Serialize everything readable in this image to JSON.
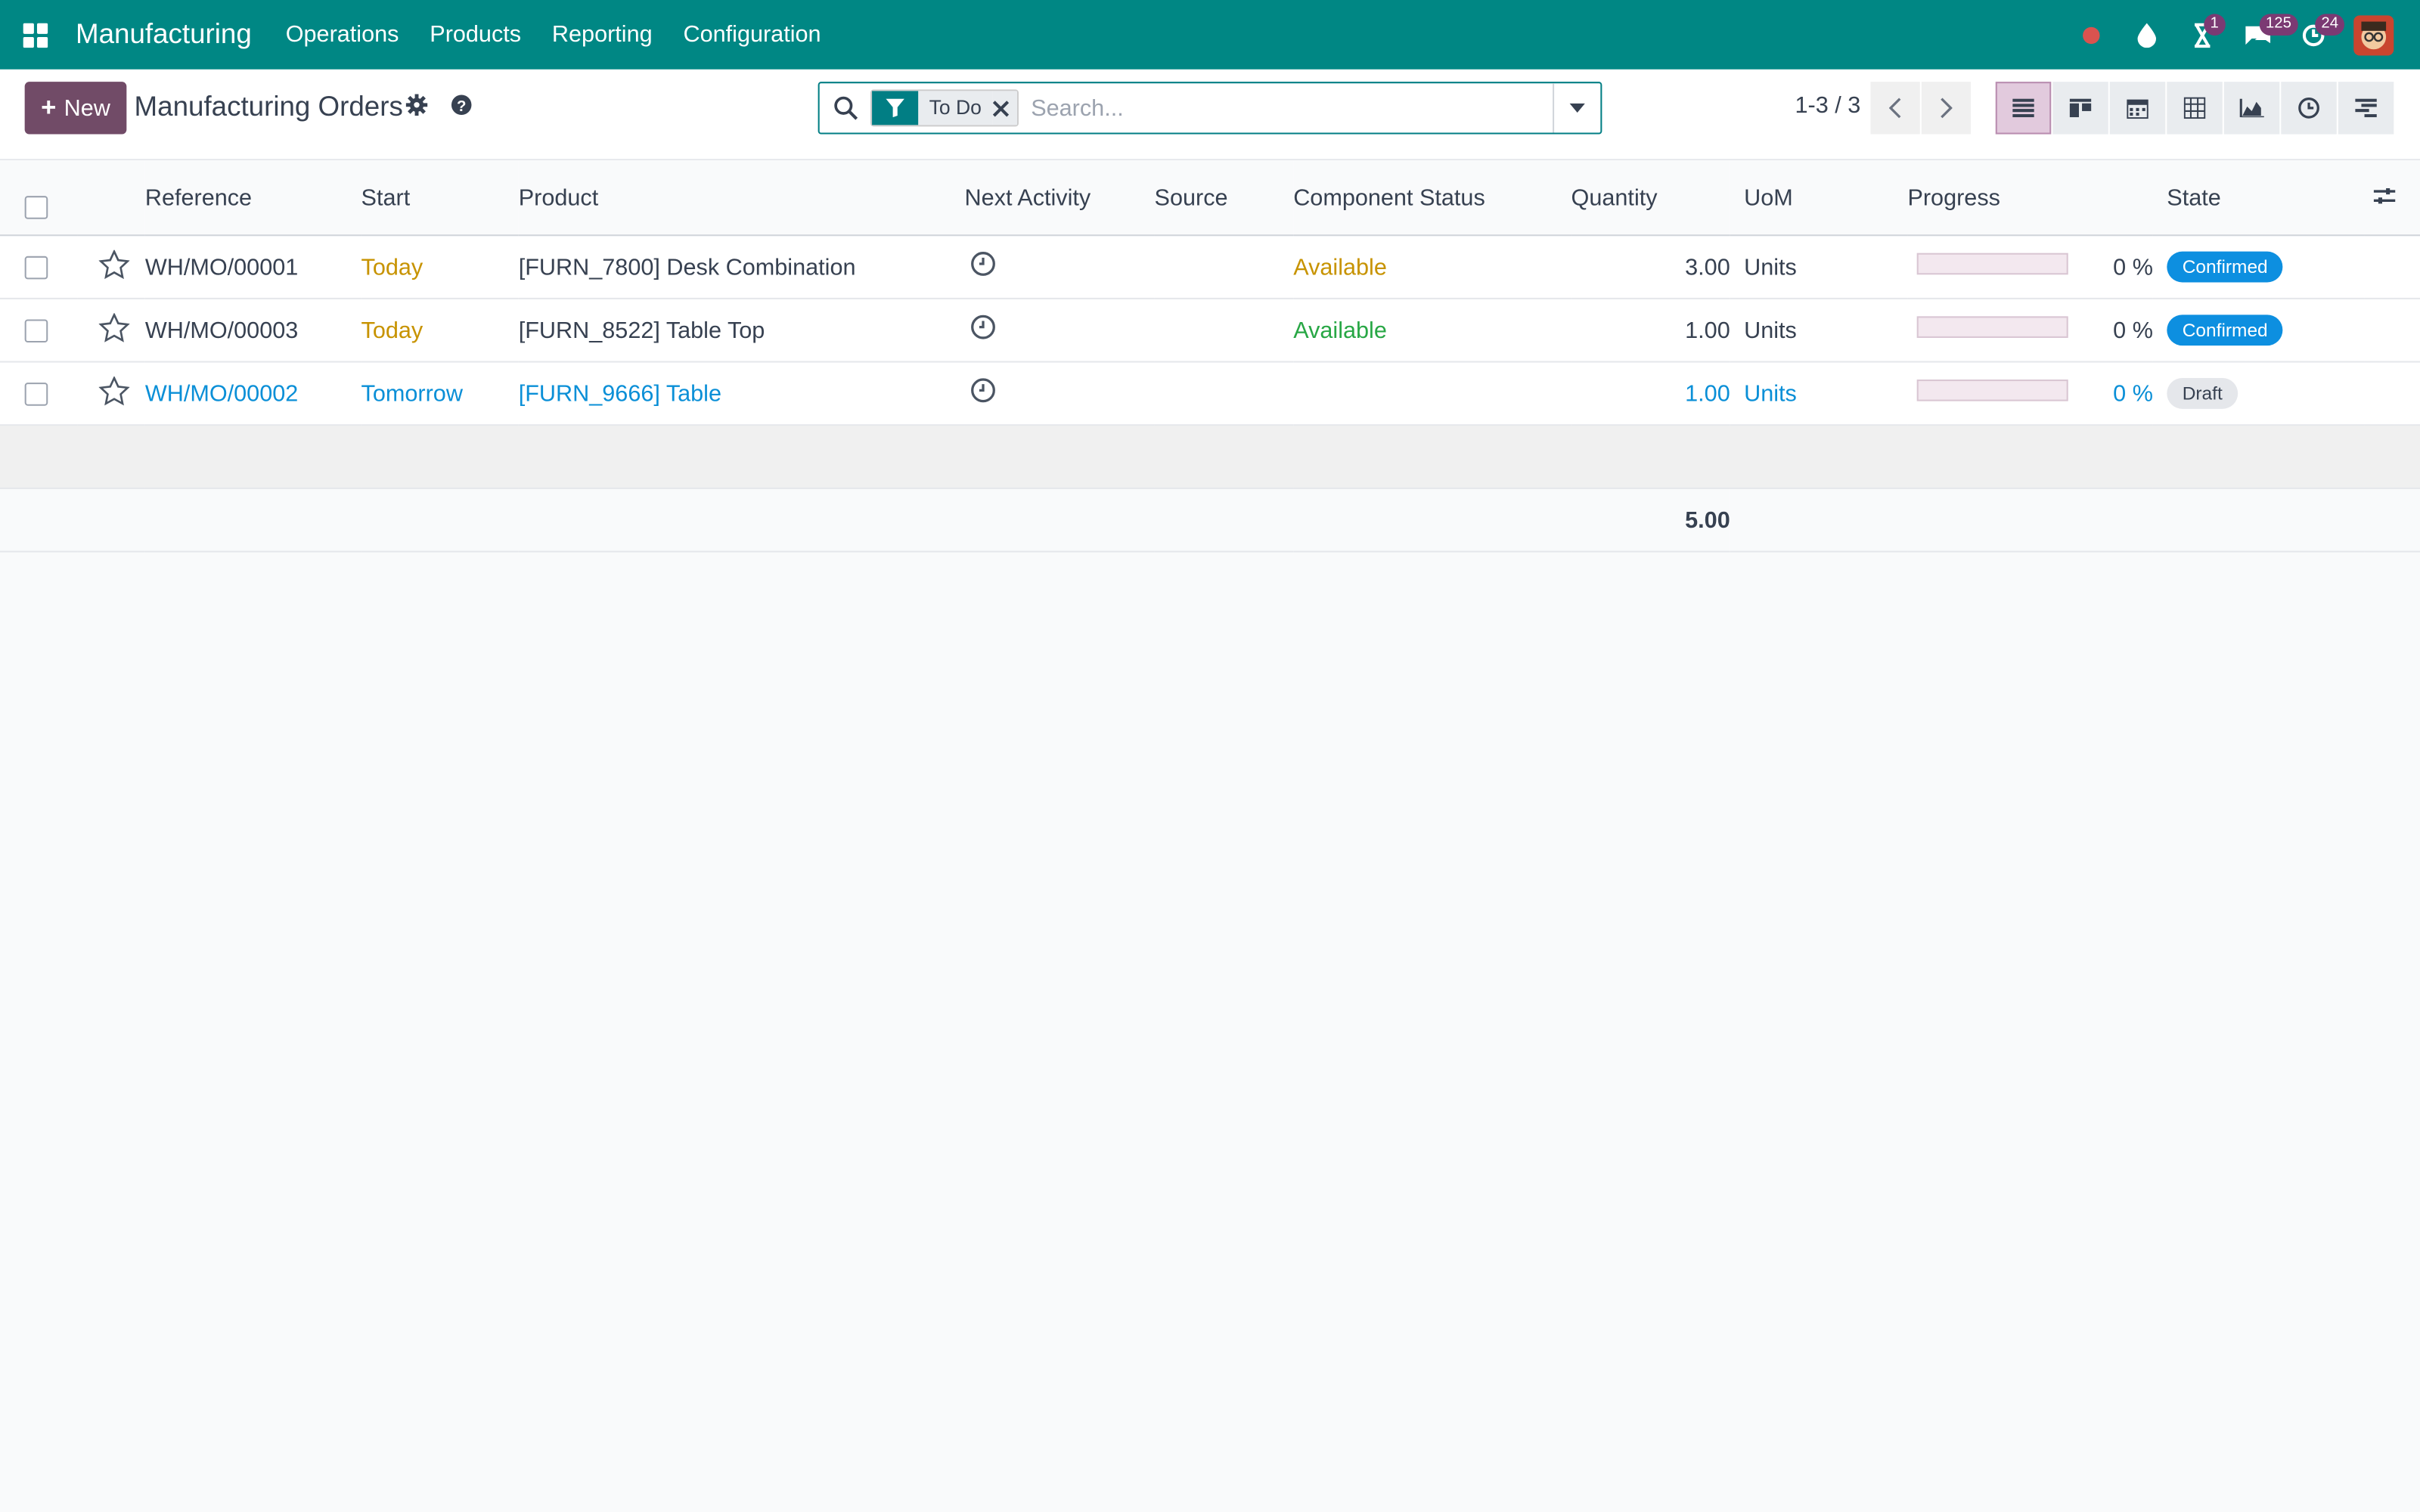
{
  "navbar": {
    "app_title": "Manufacturing",
    "menu": [
      "Operations",
      "Products",
      "Reporting",
      "Configuration"
    ],
    "badges": {
      "activities": "1",
      "messages": "125",
      "updates": "24"
    },
    "brand_color": "#008784"
  },
  "control_panel": {
    "new_label": "New",
    "page_title": "Manufacturing Orders",
    "search": {
      "facet_label": "To Do",
      "placeholder": "Search..."
    },
    "pager": "1-3 / 3"
  },
  "table": {
    "headers": {
      "reference": "Reference",
      "start": "Start",
      "product": "Product",
      "next_activity": "Next Activity",
      "source": "Source",
      "component_status": "Component Status",
      "quantity": "Quantity",
      "uom": "UoM",
      "progress": "Progress",
      "state": "State"
    },
    "rows": [
      {
        "reference": "WH/MO/00001",
        "start": "Today",
        "product": "[FURN_7800] Desk Combination",
        "source": "",
        "component_status": "Available",
        "quantity": "3.00",
        "uom": "Units",
        "progress": "0 %",
        "state": "Confirmed"
      },
      {
        "reference": "WH/MO/00003",
        "start": "Today",
        "product": "[FURN_8522] Table Top",
        "source": "",
        "component_status": "Available",
        "quantity": "1.00",
        "uom": "Units",
        "progress": "0 %",
        "state": "Confirmed"
      },
      {
        "reference": "WH/MO/00002",
        "start": "Tomorrow",
        "product": "[FURN_9666] Table",
        "source": "",
        "component_status": "",
        "quantity": "1.00",
        "uom": "Units",
        "progress": "0 %",
        "state": "Draft"
      }
    ],
    "total_quantity": "5.00"
  }
}
